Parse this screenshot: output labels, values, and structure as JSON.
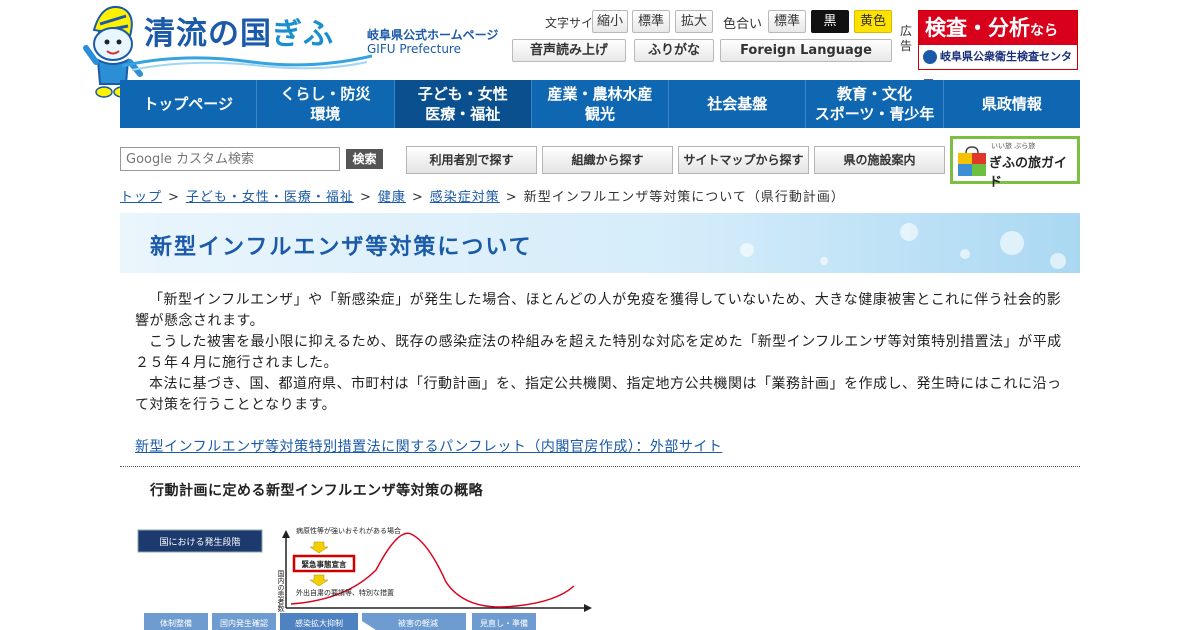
{
  "header": {
    "logo_title_main": "清流の国",
    "logo_title_gifu": "ぎふ",
    "logo_sub_jp": "岐阜県公式ホームページ",
    "logo_sub_en": "GIFU Prefecture"
  },
  "tools": {
    "font_size_label": "文字サイズ",
    "shrink": "縮小",
    "standard": "標準",
    "enlarge": "拡大",
    "color_label": "色合い",
    "color_standard": "標準",
    "color_black": "黒",
    "color_yellow": "黄色",
    "read_aloud": "音声読み上げ",
    "furigana": "ふりがな",
    "foreign_language": "Foreign Language"
  },
  "ad": {
    "label": "広告",
    "headline": "検査・分析",
    "headline_suffix": "なら",
    "org": "岐阜県公衆衛生検査センター"
  },
  "nav": {
    "items": [
      {
        "label": "トップページ"
      },
      {
        "label": "くらし・防災\n環境"
      },
      {
        "label": "子ども・女性\n医療・福祉"
      },
      {
        "label": "産業・農林水産\n観光"
      },
      {
        "label": "社会基盤"
      },
      {
        "label": "教育・文化\nスポーツ・青少年"
      },
      {
        "label": "県政情報"
      }
    ]
  },
  "search": {
    "placeholder": "Google カスタム検索",
    "button": "検索",
    "by_user": "利用者別で探す",
    "by_org": "組織から探す",
    "by_sitemap": "サイトマップから探す",
    "facilities": "県の施設案内",
    "tabi_small": "いい旅 ぶら旅",
    "tabi_guide": "ぎふの旅ガイド"
  },
  "breadcrumb": {
    "top": "トップ",
    "level1": "子ども・女性・医療・福祉",
    "level2": "健康",
    "level3": "感染症対策",
    "current": "新型インフルエンザ等対策について（県行動計画）",
    "separator": ">"
  },
  "page": {
    "title": "新型インフルエンザ等対策について",
    "paragraphs": [
      "「新型インフルエンザ」や「新感染症」が発生した場合、ほとんどの人が免疫を獲得していないため、大きな健康被害とこれに伴う社会的影響が懸念されます。",
      "こうした被害を最小限に抑えるため、既存の感染症法の枠組みを超えた特別な対応を定めた「新型インフルエンザ等対策特別措置法」が平成２５年４月に施行されました。",
      "本法に基づき、国、都道府県、市町村は「行動計画」を、指定公共機関、指定地方公共機関は「業務計画」を作成し、発生時にはこれに沿って対策を行うこととなります。"
    ],
    "pamphlet_link": "新型インフルエンザ等対策特別措置法に関するパンフレット（内閣官房作成）：外部サイト",
    "section_heading": "行動計画に定める新型インフルエンザ等対策の概略"
  },
  "diagram": {
    "stage_label": "国における発生段階",
    "severity_note": "病原性等が強いおそれがある場合",
    "emergency": "緊急事態宣言",
    "measures": "外出自粛の要請等、特別な措置",
    "yaxis": "国内の患者数",
    "phases": [
      "体制整備",
      "国内発生確認",
      "感染拡大抑制",
      "被害の軽減",
      "見直し・準備"
    ]
  }
}
